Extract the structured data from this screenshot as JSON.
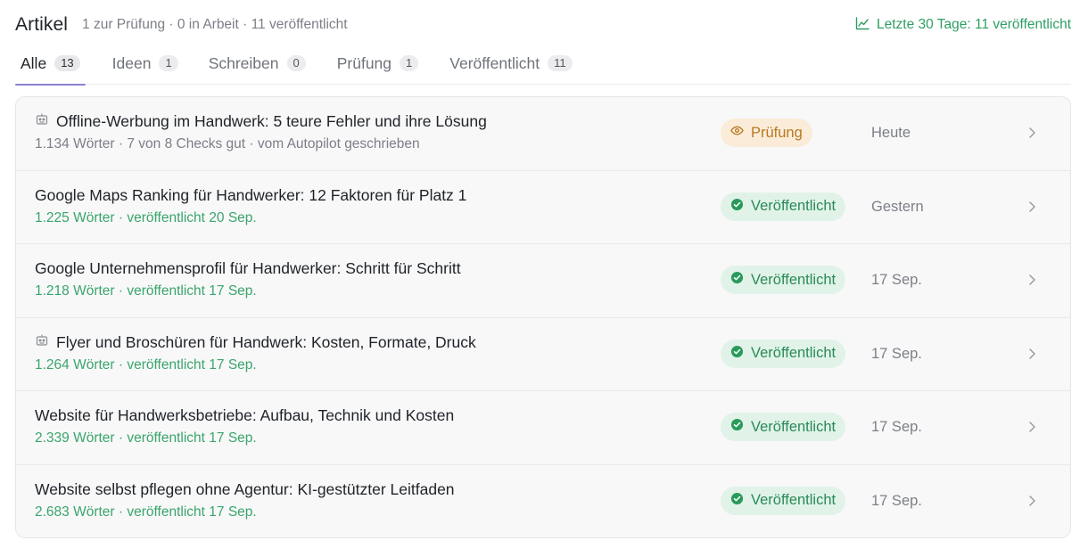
{
  "header": {
    "title": "Artikel",
    "summary": "1 zur Prüfung · 0 in Arbeit · 11 veröffentlicht",
    "stats": "Letzte 30 Tage: 11 veröffentlicht",
    "stats_icon": "trend-chart-icon"
  },
  "tabs": [
    {
      "label": "Alle",
      "count": "13",
      "active": true
    },
    {
      "label": "Ideen",
      "count": "1"
    },
    {
      "label": "Schreiben",
      "count": "0"
    },
    {
      "label": "Prüfung",
      "count": "1"
    },
    {
      "label": "Veröffentlicht",
      "count": "11"
    }
  ],
  "articles": [
    {
      "title": "Offline-Werbung im Handwerk: 5 teure Fehler und ihre Lösung",
      "meta": "1.134 Wörter · 7 von 8 Checks gut · vom Autopilot geschrieben",
      "status": "Prüfung",
      "status_icon": "eye-icon",
      "date": "Heute",
      "has_autopilot_icon": true
    },
    {
      "title": "Google Maps Ranking für Handwerker: 12 Faktoren für Platz 1",
      "meta": "1.225 Wörter · veröffentlicht 20 Sep.",
      "status": "Veröffentlicht",
      "status_icon": "check-circle-icon",
      "date": "Gestern"
    },
    {
      "title": "Google Unternehmensprofil für Handwerker: Schritt für Schritt",
      "meta": "1.218 Wörter · veröffentlicht 17 Sep.",
      "status": "Veröffentlicht",
      "status_icon": "check-circle-icon",
      "date": "17 Sep."
    },
    {
      "title": "Flyer und Broschüren für Handwerk: Kosten, Formate, Druck",
      "meta": "1.264 Wörter · veröffentlicht 17 Sep.",
      "status": "Veröffentlicht",
      "status_icon": "check-circle-icon",
      "date": "17 Sep.",
      "has_autopilot_icon": true
    },
    {
      "title": "Website für Handwerksbetriebe: Aufbau, Technik und Kosten",
      "meta": "2.339 Wörter · veröffentlicht 17 Sep.",
      "status": "Veröffentlicht",
      "status_icon": "check-circle-icon",
      "date": "17 Sep."
    },
    {
      "title": "Website selbst pflegen ohne Agentur: KI-gestützter Leitfaden",
      "meta": "2.683 Wörter · veröffentlicht 17 Sep.",
      "status": "Veröffentlicht",
      "status_icon": "check-circle-icon",
      "date": "17 Sep."
    }
  ],
  "colors": {
    "accent_tab": "#8a82cf",
    "published": "#2a8a57",
    "review": "#b8791f",
    "stats_green": "#2e9e63"
  }
}
